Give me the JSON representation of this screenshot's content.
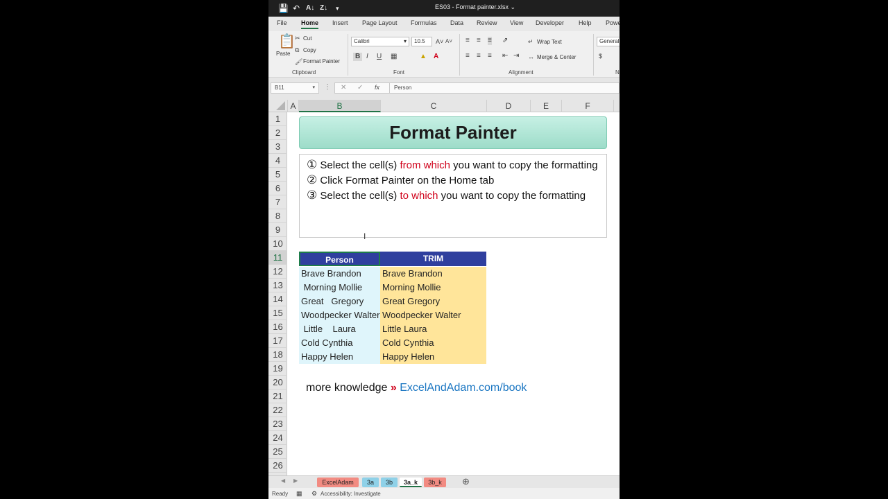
{
  "window": {
    "title": "ES03 - Format painter.xlsx",
    "quick_access": [
      "save-icon",
      "undo-icon",
      "sort-asc-icon",
      "sort-desc-icon",
      "customize-icon"
    ]
  },
  "menu_tabs": [
    "File",
    "Home",
    "Insert",
    "Page Layout",
    "Formulas",
    "Data",
    "Review",
    "View",
    "Developer",
    "Help",
    "Powe"
  ],
  "active_tab": "Home",
  "ribbon": {
    "clipboard": {
      "paste": "Paste",
      "cut": "Cut",
      "copy": "Copy",
      "format_painter": "Format Painter",
      "label": "Clipboard"
    },
    "font": {
      "font_name": "Calibri",
      "font_size": "10.5",
      "bold": "B",
      "italic": "I",
      "underline": "U",
      "label": "Font"
    },
    "alignment": {
      "wrap_text": "Wrap Text",
      "merge_center": "Merge & Center",
      "label": "Alignment"
    },
    "number": {
      "format": "General",
      "label": "N"
    }
  },
  "formula_bar": {
    "name_box": "B11",
    "value": "Person"
  },
  "columns": [
    "A",
    "B",
    "C",
    "D",
    "E",
    "F"
  ],
  "selected_column": "B",
  "rows": [
    "1",
    "2",
    "3",
    "4",
    "5",
    "6",
    "7",
    "8",
    "9",
    "10",
    "11",
    "12",
    "13",
    "14",
    "15",
    "16",
    "17",
    "18",
    "19",
    "20",
    "21",
    "22",
    "23",
    "24",
    "25",
    "26"
  ],
  "selected_row": "11",
  "sheet": {
    "banner": "Format Painter",
    "instructions": {
      "step1_num": "①",
      "step1_a": "Select the cell(s) ",
      "step1_red": "from which",
      "step1_b": " you want to copy the formatting",
      "step2_num": "②",
      "step2": "Click Format Painter on the Home tab",
      "step3_num": "③",
      "step3_a": "Select the cell(s) ",
      "step3_red": "to which",
      "step3_b": " you want to copy the formatting"
    },
    "table": {
      "headers": [
        "Person",
        "TRIM"
      ],
      "person": [
        "Brave Brandon",
        " Morning Mollie",
        "Great   Gregory",
        "Woodpecker Walter",
        " Little    Laura",
        "Cold Cynthia",
        "Happy Helen"
      ],
      "trim": [
        "Brave Brandon",
        "Morning Mollie",
        "Great Gregory",
        "Woodpecker Walter",
        "Little Laura",
        "Cold Cynthia",
        "Happy Helen"
      ]
    },
    "more": {
      "text": "more knowledge ",
      "arrow": "»",
      "link": " ExcelAndAdam.com/book"
    }
  },
  "sheet_tabs": [
    {
      "label": "ExcelAdam",
      "color": "#f28b82"
    },
    {
      "label": "3a",
      "color": "#8fd1e8"
    },
    {
      "label": "3b",
      "color": "#8fd1e8"
    },
    {
      "label": "3a_k",
      "color": "#ffffff"
    },
    {
      "label": "3b_k",
      "color": "#f28b82"
    }
  ],
  "active_sheet": "3a_k",
  "status": {
    "ready": "Ready",
    "accessibility": "Accessibility: Investigate"
  }
}
